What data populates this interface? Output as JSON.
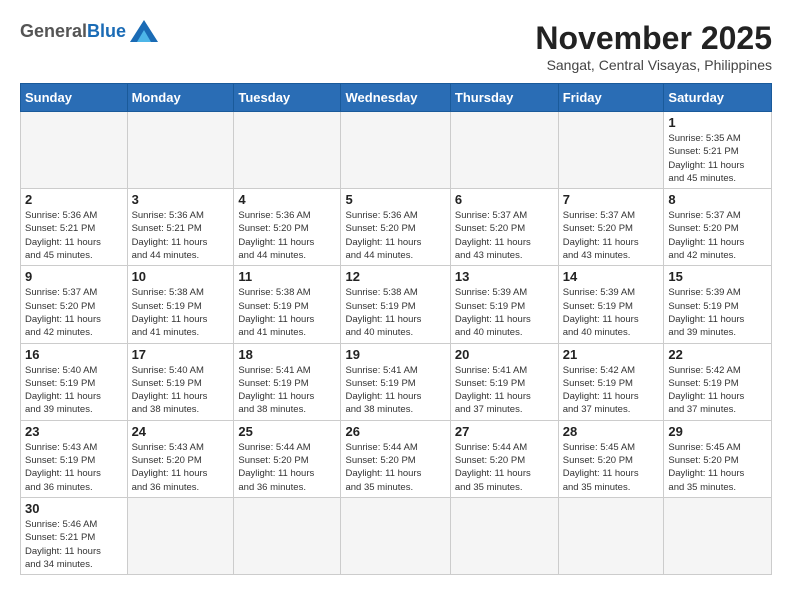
{
  "header": {
    "logo_general": "General",
    "logo_blue": "Blue",
    "month_title": "November 2025",
    "subtitle": "Sangat, Central Visayas, Philippines"
  },
  "days_of_week": [
    "Sunday",
    "Monday",
    "Tuesday",
    "Wednesday",
    "Thursday",
    "Friday",
    "Saturday"
  ],
  "weeks": [
    [
      {
        "day": "",
        "info": ""
      },
      {
        "day": "",
        "info": ""
      },
      {
        "day": "",
        "info": ""
      },
      {
        "day": "",
        "info": ""
      },
      {
        "day": "",
        "info": ""
      },
      {
        "day": "",
        "info": ""
      },
      {
        "day": "1",
        "info": "Sunrise: 5:35 AM\nSunset: 5:21 PM\nDaylight: 11 hours\nand 45 minutes."
      }
    ],
    [
      {
        "day": "2",
        "info": "Sunrise: 5:36 AM\nSunset: 5:21 PM\nDaylight: 11 hours\nand 45 minutes."
      },
      {
        "day": "3",
        "info": "Sunrise: 5:36 AM\nSunset: 5:21 PM\nDaylight: 11 hours\nand 44 minutes."
      },
      {
        "day": "4",
        "info": "Sunrise: 5:36 AM\nSunset: 5:20 PM\nDaylight: 11 hours\nand 44 minutes."
      },
      {
        "day": "5",
        "info": "Sunrise: 5:36 AM\nSunset: 5:20 PM\nDaylight: 11 hours\nand 44 minutes."
      },
      {
        "day": "6",
        "info": "Sunrise: 5:37 AM\nSunset: 5:20 PM\nDaylight: 11 hours\nand 43 minutes."
      },
      {
        "day": "7",
        "info": "Sunrise: 5:37 AM\nSunset: 5:20 PM\nDaylight: 11 hours\nand 43 minutes."
      },
      {
        "day": "8",
        "info": "Sunrise: 5:37 AM\nSunset: 5:20 PM\nDaylight: 11 hours\nand 42 minutes."
      }
    ],
    [
      {
        "day": "9",
        "info": "Sunrise: 5:37 AM\nSunset: 5:20 PM\nDaylight: 11 hours\nand 42 minutes."
      },
      {
        "day": "10",
        "info": "Sunrise: 5:38 AM\nSunset: 5:19 PM\nDaylight: 11 hours\nand 41 minutes."
      },
      {
        "day": "11",
        "info": "Sunrise: 5:38 AM\nSunset: 5:19 PM\nDaylight: 11 hours\nand 41 minutes."
      },
      {
        "day": "12",
        "info": "Sunrise: 5:38 AM\nSunset: 5:19 PM\nDaylight: 11 hours\nand 40 minutes."
      },
      {
        "day": "13",
        "info": "Sunrise: 5:39 AM\nSunset: 5:19 PM\nDaylight: 11 hours\nand 40 minutes."
      },
      {
        "day": "14",
        "info": "Sunrise: 5:39 AM\nSunset: 5:19 PM\nDaylight: 11 hours\nand 40 minutes."
      },
      {
        "day": "15",
        "info": "Sunrise: 5:39 AM\nSunset: 5:19 PM\nDaylight: 11 hours\nand 39 minutes."
      }
    ],
    [
      {
        "day": "16",
        "info": "Sunrise: 5:40 AM\nSunset: 5:19 PM\nDaylight: 11 hours\nand 39 minutes."
      },
      {
        "day": "17",
        "info": "Sunrise: 5:40 AM\nSunset: 5:19 PM\nDaylight: 11 hours\nand 38 minutes."
      },
      {
        "day": "18",
        "info": "Sunrise: 5:41 AM\nSunset: 5:19 PM\nDaylight: 11 hours\nand 38 minutes."
      },
      {
        "day": "19",
        "info": "Sunrise: 5:41 AM\nSunset: 5:19 PM\nDaylight: 11 hours\nand 38 minutes."
      },
      {
        "day": "20",
        "info": "Sunrise: 5:41 AM\nSunset: 5:19 PM\nDaylight: 11 hours\nand 37 minutes."
      },
      {
        "day": "21",
        "info": "Sunrise: 5:42 AM\nSunset: 5:19 PM\nDaylight: 11 hours\nand 37 minutes."
      },
      {
        "day": "22",
        "info": "Sunrise: 5:42 AM\nSunset: 5:19 PM\nDaylight: 11 hours\nand 37 minutes."
      }
    ],
    [
      {
        "day": "23",
        "info": "Sunrise: 5:43 AM\nSunset: 5:19 PM\nDaylight: 11 hours\nand 36 minutes."
      },
      {
        "day": "24",
        "info": "Sunrise: 5:43 AM\nSunset: 5:20 PM\nDaylight: 11 hours\nand 36 minutes."
      },
      {
        "day": "25",
        "info": "Sunrise: 5:44 AM\nSunset: 5:20 PM\nDaylight: 11 hours\nand 36 minutes."
      },
      {
        "day": "26",
        "info": "Sunrise: 5:44 AM\nSunset: 5:20 PM\nDaylight: 11 hours\nand 35 minutes."
      },
      {
        "day": "27",
        "info": "Sunrise: 5:44 AM\nSunset: 5:20 PM\nDaylight: 11 hours\nand 35 minutes."
      },
      {
        "day": "28",
        "info": "Sunrise: 5:45 AM\nSunset: 5:20 PM\nDaylight: 11 hours\nand 35 minutes."
      },
      {
        "day": "29",
        "info": "Sunrise: 5:45 AM\nSunset: 5:20 PM\nDaylight: 11 hours\nand 35 minutes."
      }
    ],
    [
      {
        "day": "30",
        "info": "Sunrise: 5:46 AM\nSunset: 5:21 PM\nDaylight: 11 hours\nand 34 minutes."
      },
      {
        "day": "",
        "info": ""
      },
      {
        "day": "",
        "info": ""
      },
      {
        "day": "",
        "info": ""
      },
      {
        "day": "",
        "info": ""
      },
      {
        "day": "",
        "info": ""
      },
      {
        "day": "",
        "info": ""
      }
    ]
  ]
}
